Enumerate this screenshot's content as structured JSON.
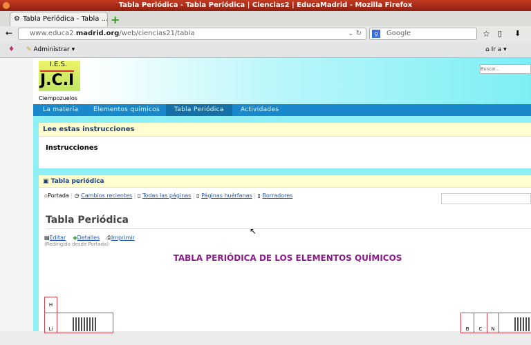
{
  "window": {
    "title": "Tabla Periódica - Tabla Periódica | Ciencias2 | EducaMadrid - Mozilla Firefox"
  },
  "tab": {
    "label": "Tabla Periódica - Tabla ...",
    "new_tab": "+"
  },
  "address": {
    "prefix": "www.educa2.",
    "domain": "madrid.org",
    "path": "/web/ciencias21/tabla"
  },
  "search": {
    "placeholder": "Google"
  },
  "bookmarks": {
    "admin": "Administrar ▾",
    "goto": "Ir a ▾"
  },
  "site": {
    "logo": {
      "line1": "I.E.S.",
      "line2": "J.C.I",
      "line3": "Ciempozuelos"
    },
    "search_placeholder": "Buscar...",
    "menu": [
      "La materia",
      "Elementos químicos",
      "Tabla Periódica",
      "Actividades"
    ]
  },
  "instructions": {
    "header": "Lee estas instrucciones",
    "body": "Instrucciones"
  },
  "wiki": {
    "header": "Tabla periódica",
    "nav": [
      "Portada",
      "Cambios recientes",
      "Todas las páginas",
      "Páginas huérfanas",
      "Borradores"
    ],
    "title": "Tabla Periódica",
    "actions": [
      "Editar",
      "Detalles",
      "Imprimir"
    ],
    "redirect": "(Redirigido desde Portada)",
    "heading": "TABLA PERIÓDICA DE LOS ELEMENTOS QUÍMICOS",
    "elements": [
      "H",
      "Li",
      "B",
      "C",
      "N"
    ]
  }
}
